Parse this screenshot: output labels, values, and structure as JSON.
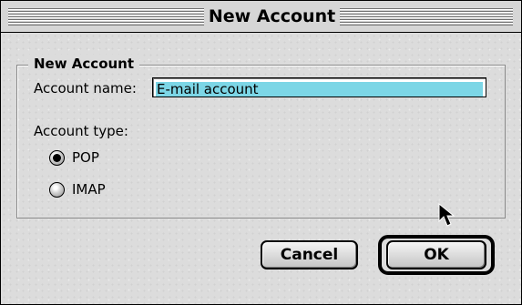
{
  "window": {
    "title": "New Account"
  },
  "group": {
    "legend": "New Account"
  },
  "account_name": {
    "label": "Account name:",
    "value": "E-mail account"
  },
  "account_type": {
    "label": "Account type:",
    "options": [
      {
        "label": "POP",
        "selected": true
      },
      {
        "label": "IMAP",
        "selected": false
      }
    ]
  },
  "buttons": {
    "cancel": "Cancel",
    "ok": "OK"
  },
  "icons": {
    "pointer": "arrow-cursor-icon"
  }
}
